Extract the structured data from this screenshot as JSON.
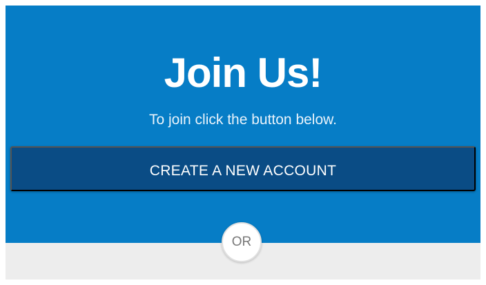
{
  "panel": {
    "title": "Join Us!",
    "subtitle": "To join click the button below.",
    "create_button_label": "CREATE A NEW ACCOUNT",
    "separator_label": "OR"
  },
  "colors": {
    "panel_background": "#067dc6",
    "button_background": "#0a4c85",
    "bottom_background": "#ededed"
  }
}
